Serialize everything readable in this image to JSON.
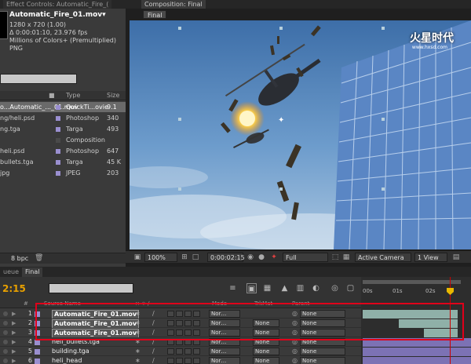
{
  "project_panel": {
    "tab_label": "Effect Controls: Automatic_Fire_(",
    "selected_title": "Automatic_Fire_01.mov▾",
    "info_lines": [
      "1280 x 720 (1.00)",
      "Δ 0:00:01:10, 23.976 fps",
      "Millions of Colors+ (Premultiplied)",
      "PNG"
    ],
    "columns": {
      "type": "Type",
      "size": "Size"
    },
    "items": [
      {
        "name": "o...Automatic_..._01.mov",
        "type": "QuickTi...ovie",
        "size": "9.1",
        "color": "#9a8fd0",
        "selected": true
      },
      {
        "name": "ng/heli.psd",
        "type": "Photoshop",
        "size": "340",
        "color": "#9a8fd0",
        "selected": false
      },
      {
        "name": "ng.tga",
        "type": "Targa",
        "size": "493",
        "color": "#9a8fd0",
        "selected": false
      },
      {
        "name": "",
        "type": "Composition",
        "size": "",
        "color": "#4a4a4a",
        "selected": false
      },
      {
        "name": "heli.psd",
        "type": "Photoshop",
        "size": "647",
        "color": "#9a8fd0",
        "selected": false
      },
      {
        "name": "bullets.tga",
        "type": "Targa",
        "size": "45 K",
        "color": "#9a8fd0",
        "selected": false
      },
      {
        "name": "jpg",
        "type": "JPEG",
        "size": "203",
        "color": "#9a8fd0",
        "selected": false
      }
    ],
    "bpc": "8 bpc"
  },
  "composition": {
    "tab_label": "Composition: Final",
    "comp_button": "Final",
    "watermark": "火星时代",
    "watermark_sub": "www.hxsd.com",
    "controls": {
      "zoom": "100%",
      "timecode": "0:00:02:15",
      "resolution": "Full",
      "camera": "Active Camera",
      "views": "1 View"
    }
  },
  "timeline": {
    "queue_tab": "ueue",
    "final_tab": "Final",
    "timecode": "2:15",
    "columns": {
      "num": "#",
      "source": "Source Name",
      "mode": "Mode",
      "trkmat": "TrkMat",
      "parent": "Parent"
    },
    "ruler": [
      "00s",
      "01s",
      "02s"
    ],
    "layers": [
      {
        "num": "1",
        "name": "Automatic_Fire_01.mov",
        "mode": "Nor…",
        "trkmat": "",
        "parent": "None",
        "color": "#9a8fd0",
        "boxed": true,
        "bar_start": 2,
        "bar_end": 123,
        "bar_color": "#8fb0a8"
      },
      {
        "num": "2",
        "name": "Automatic_Fire_01.mov",
        "mode": "Nor…",
        "trkmat": "None",
        "parent": "None",
        "color": "#9a8fd0",
        "boxed": true,
        "bar_start": 48,
        "bar_end": 123,
        "bar_color": "#8fb0a8"
      },
      {
        "num": "3",
        "name": "Automatic_Fire_01.mov",
        "mode": "Nor…",
        "trkmat": "None",
        "parent": "None",
        "color": "#9a8fd0",
        "boxed": true,
        "bar_start": 80,
        "bar_end": 123,
        "bar_color": "#8fb0a8"
      },
      {
        "num": "4",
        "name": "heli_bullets.tga",
        "mode": "Nor…",
        "trkmat": "None",
        "parent": "None",
        "color": "#9a8fd0",
        "boxed": false,
        "bar_start": 2,
        "bar_end": 140,
        "bar_color": "#7c72b4"
      },
      {
        "num": "5",
        "name": "building.tga",
        "mode": "Nor…",
        "trkmat": "None",
        "parent": "None",
        "color": "#9a8fd0",
        "boxed": false,
        "bar_start": 2,
        "bar_end": 140,
        "bar_color": "#7c72b4"
      },
      {
        "num": "6",
        "name": "heli_head",
        "mode": "Nor…",
        "trkmat": "None",
        "parent": "None",
        "color": "#9a8fd0",
        "boxed": false,
        "bar_start": 2,
        "bar_end": 140,
        "bar_color": "#7c72b4"
      }
    ]
  }
}
